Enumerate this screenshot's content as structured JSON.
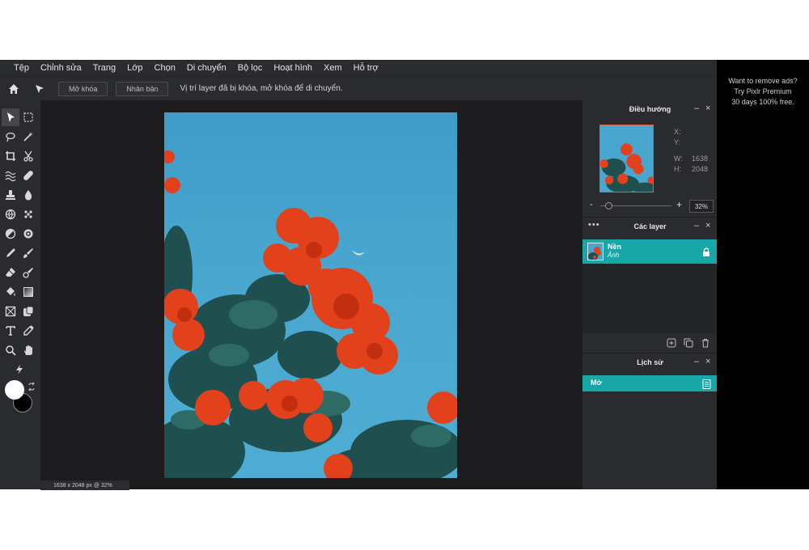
{
  "menu": [
    "Tệp",
    "Chỉnh sửa",
    "Trang",
    "Lớp",
    "Chọn",
    "Di chuyển",
    "Bộ lọc",
    "Hoạt hình",
    "Xem",
    "Hỗ trợ"
  ],
  "options_bar": {
    "unlock_label": "Mở khóa",
    "duplicate_label": "Nhân bản",
    "message": "Vị trí layer đã bị khóa, mở khóa để di chuyển."
  },
  "status": {
    "image_info": "1638 x 2048 px @ 32%"
  },
  "navigator": {
    "title": "Điều hướng",
    "x_label": "X:",
    "y_label": "Y:",
    "w_label": "W:",
    "h_label": "H:",
    "w_value": "1638",
    "h_value": "2048",
    "zoom_value": "32%",
    "minus": "-",
    "plus": "+"
  },
  "layers": {
    "title": "Các layer",
    "items": [
      {
        "name": "Nền",
        "subtitle": "Ảnh"
      }
    ]
  },
  "history": {
    "title": "Lịch sử",
    "items": [
      {
        "label": "Mở"
      }
    ]
  },
  "ad": {
    "line1": "Want to remove ads?",
    "line2": "Try Pixlr Premium",
    "line3": "30 days 100% free."
  },
  "colors": {
    "accent": "#19a6a6",
    "sky": "#48a6cf",
    "flower": "#e8401c",
    "foreground_swatch": "#ffffff",
    "background_swatch": "#000000"
  }
}
